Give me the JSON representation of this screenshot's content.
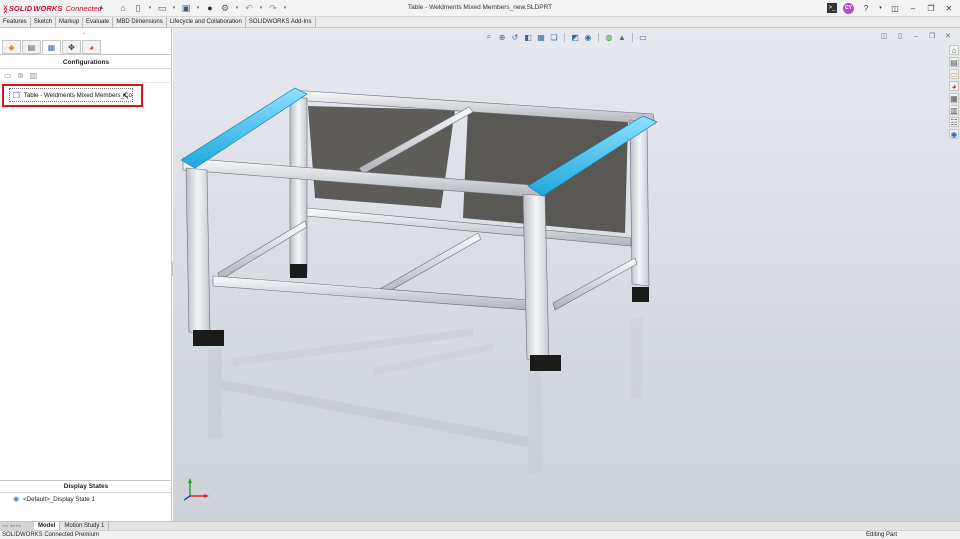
{
  "app": {
    "brand_prefix": "SOLID",
    "brand_suffix": "WORKS",
    "brand_connected": "Connected",
    "document_title": "Table - Weldments Mixed Members_new.SLDPRT",
    "user_initials": "CY"
  },
  "quick_access": {
    "icons": [
      "home-icon",
      "new-document-icon",
      "open-icon",
      "save-icon",
      "print-icon",
      "options-icon",
      "undo-icon",
      "redo-icon"
    ]
  },
  "command_tabs": [
    "Features",
    "Sketch",
    "Markup",
    "Evaluate",
    "MBD Dimensions",
    "Lifecycle and Collaboration",
    "SOLIDWORKS Add-Ins"
  ],
  "configuration_manager": {
    "title": "Configurations",
    "items": [
      {
        "label": "Table - Weldments Mixed Members_Con"
      }
    ]
  },
  "display_states": {
    "title": "Display States",
    "items": [
      {
        "label": "<Default>_Display State 1"
      }
    ]
  },
  "bottom_tabs": [
    "Model",
    "Motion Study 1"
  ],
  "bottom_nav_label": "◂ ▸ ◂◂ ▸▸",
  "status_bar": {
    "left": "SOLIDWORKS Connected Premium",
    "right": "Editing Part"
  },
  "colors": {
    "selection_highlight": "#d8141f",
    "selected_member": "#29b6e8",
    "brand_red": "#c8102e"
  }
}
